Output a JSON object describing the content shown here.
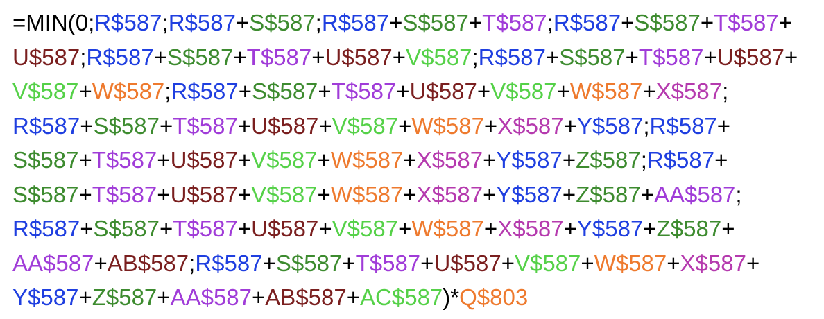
{
  "formula": {
    "colors": {
      "k": "#000000",
      "r": "#1F3FE0",
      "s": "#3D8B2F",
      "t": "#A03CD8",
      "u": "#7A1F1F",
      "v": "#55D148",
      "w": "#EE7A2E",
      "x": "#B53AAE",
      "y": "#1F3FE0",
      "z": "#3D8B2F",
      "aa": "#A03CD8",
      "ab": "#7A1F1F",
      "ac": "#55D148",
      "q": "#EE7A2E"
    },
    "lines": [
      [
        [
          "=MIN(0;",
          "k"
        ],
        [
          "R$587",
          "r"
        ],
        [
          ";",
          "k"
        ],
        [
          "R$587",
          "r"
        ],
        [
          "+",
          "k"
        ],
        [
          "S$587",
          "s"
        ],
        [
          ";",
          "k"
        ],
        [
          "R$587",
          "r"
        ],
        [
          "+",
          "k"
        ],
        [
          "S$587",
          "s"
        ],
        [
          "+",
          "k"
        ],
        [
          "T$587",
          "t"
        ],
        [
          ";",
          "k"
        ],
        [
          "R$587",
          "r"
        ],
        [
          "+",
          "k"
        ],
        [
          "S$587",
          "s"
        ],
        [
          "+",
          "k"
        ],
        [
          "T$587",
          "t"
        ],
        [
          "+",
          "k"
        ]
      ],
      [
        [
          "U$587",
          "u"
        ],
        [
          ";",
          "k"
        ],
        [
          "R$587",
          "r"
        ],
        [
          "+",
          "k"
        ],
        [
          "S$587",
          "s"
        ],
        [
          "+",
          "k"
        ],
        [
          "T$587",
          "t"
        ],
        [
          "+",
          "k"
        ],
        [
          "U$587",
          "u"
        ],
        [
          "+",
          "k"
        ],
        [
          "V$587",
          "v"
        ],
        [
          ";",
          "k"
        ],
        [
          "R$587",
          "r"
        ],
        [
          "+",
          "k"
        ],
        [
          "S$587",
          "s"
        ],
        [
          "+",
          "k"
        ],
        [
          "T$587",
          "t"
        ],
        [
          "+",
          "k"
        ],
        [
          "U$587",
          "u"
        ],
        [
          "+",
          "k"
        ]
      ],
      [
        [
          "V$587",
          "v"
        ],
        [
          "+",
          "k"
        ],
        [
          "W$587",
          "w"
        ],
        [
          ";",
          "k"
        ],
        [
          "R$587",
          "r"
        ],
        [
          "+",
          "k"
        ],
        [
          "S$587",
          "s"
        ],
        [
          "+",
          "k"
        ],
        [
          "T$587",
          "t"
        ],
        [
          "+",
          "k"
        ],
        [
          "U$587",
          "u"
        ],
        [
          "+",
          "k"
        ],
        [
          "V$587",
          "v"
        ],
        [
          "+",
          "k"
        ],
        [
          "W$587",
          "w"
        ],
        [
          "+",
          "k"
        ],
        [
          "X$587",
          "x"
        ],
        [
          ";",
          "k"
        ]
      ],
      [
        [
          "R$587",
          "r"
        ],
        [
          "+",
          "k"
        ],
        [
          "S$587",
          "s"
        ],
        [
          "+",
          "k"
        ],
        [
          "T$587",
          "t"
        ],
        [
          "+",
          "k"
        ],
        [
          "U$587",
          "u"
        ],
        [
          "+",
          "k"
        ],
        [
          "V$587",
          "v"
        ],
        [
          "+",
          "k"
        ],
        [
          "W$587",
          "w"
        ],
        [
          "+",
          "k"
        ],
        [
          "X$587",
          "x"
        ],
        [
          "+",
          "k"
        ],
        [
          "Y$587",
          "y"
        ],
        [
          ";",
          "k"
        ],
        [
          "R$587",
          "r"
        ],
        [
          "+",
          "k"
        ]
      ],
      [
        [
          "S$587",
          "s"
        ],
        [
          "+",
          "k"
        ],
        [
          "T$587",
          "t"
        ],
        [
          "+",
          "k"
        ],
        [
          "U$587",
          "u"
        ],
        [
          "+",
          "k"
        ],
        [
          "V$587",
          "v"
        ],
        [
          "+",
          "k"
        ],
        [
          "W$587",
          "w"
        ],
        [
          "+",
          "k"
        ],
        [
          "X$587",
          "x"
        ],
        [
          "+",
          "k"
        ],
        [
          "Y$587",
          "y"
        ],
        [
          "+",
          "k"
        ],
        [
          "Z$587",
          "z"
        ],
        [
          ";",
          "k"
        ],
        [
          "R$587",
          "r"
        ],
        [
          "+",
          "k"
        ]
      ],
      [
        [
          "S$587",
          "s"
        ],
        [
          "+",
          "k"
        ],
        [
          "T$587",
          "t"
        ],
        [
          "+",
          "k"
        ],
        [
          "U$587",
          "u"
        ],
        [
          "+",
          "k"
        ],
        [
          "V$587",
          "v"
        ],
        [
          "+",
          "k"
        ],
        [
          "W$587",
          "w"
        ],
        [
          "+",
          "k"
        ],
        [
          "X$587",
          "x"
        ],
        [
          "+",
          "k"
        ],
        [
          "Y$587",
          "y"
        ],
        [
          "+",
          "k"
        ],
        [
          "Z$587",
          "z"
        ],
        [
          "+",
          "k"
        ],
        [
          "AA$587",
          "aa"
        ],
        [
          ";",
          "k"
        ]
      ],
      [
        [
          "R$587",
          "r"
        ],
        [
          "+",
          "k"
        ],
        [
          "S$587",
          "s"
        ],
        [
          "+",
          "k"
        ],
        [
          "T$587",
          "t"
        ],
        [
          "+",
          "k"
        ],
        [
          "U$587",
          "u"
        ],
        [
          "+",
          "k"
        ],
        [
          "V$587",
          "v"
        ],
        [
          "+",
          "k"
        ],
        [
          "W$587",
          "w"
        ],
        [
          "+",
          "k"
        ],
        [
          "X$587",
          "x"
        ],
        [
          "+",
          "k"
        ],
        [
          "Y$587",
          "y"
        ],
        [
          "+",
          "k"
        ],
        [
          "Z$587",
          "z"
        ],
        [
          "+",
          "k"
        ]
      ],
      [
        [
          "AA$587",
          "aa"
        ],
        [
          "+",
          "k"
        ],
        [
          "AB$587",
          "ab"
        ],
        [
          ";",
          "k"
        ],
        [
          "R$587",
          "r"
        ],
        [
          "+",
          "k"
        ],
        [
          "S$587",
          "s"
        ],
        [
          "+",
          "k"
        ],
        [
          "T$587",
          "t"
        ],
        [
          "+",
          "k"
        ],
        [
          "U$587",
          "u"
        ],
        [
          "+",
          "k"
        ],
        [
          "V$587",
          "v"
        ],
        [
          "+",
          "k"
        ],
        [
          "W$587",
          "w"
        ],
        [
          "+",
          "k"
        ],
        [
          "X$587",
          "x"
        ],
        [
          "+",
          "k"
        ]
      ],
      [
        [
          "Y$587",
          "y"
        ],
        [
          "+",
          "k"
        ],
        [
          "Z$587",
          "z"
        ],
        [
          "+",
          "k"
        ],
        [
          "AA$587",
          "aa"
        ],
        [
          "+",
          "k"
        ],
        [
          "AB$587",
          "ab"
        ],
        [
          "+",
          "k"
        ],
        [
          "AC$587",
          "ac"
        ],
        [
          ")*",
          "k"
        ],
        [
          "Q$803",
          "q"
        ]
      ]
    ]
  }
}
